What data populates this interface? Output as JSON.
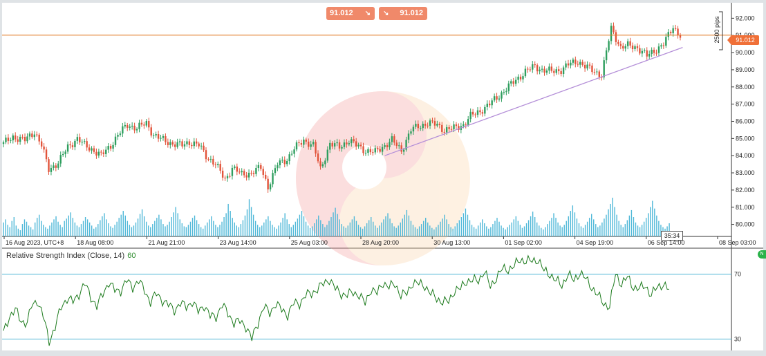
{
  "quotes": {
    "sell_price": "91.012",
    "buy_price": "91.012",
    "sell_arrow": "↘",
    "buy_arrow": "↘"
  },
  "price_tag": "91.012",
  "pips_label": "2500 pips",
  "timer": "35:34",
  "rsi_label": {
    "name": "Relative Strength Index (Close, 14)",
    "value": "60"
  },
  "green_tab_icon": "N",
  "colors": {
    "up": "#2e9e5e",
    "down": "#e2533a",
    "volume": "#4fb8d8",
    "price_line": "#e07a25",
    "trendline": "#b48fd8",
    "rsi_line": "#1c7a1c",
    "rsi_level": "#4cb3d4"
  },
  "chart_data": [
    {
      "type": "candlestick",
      "xlabels": [
        "16 Aug 2023, UTC+8",
        "18 Aug 08:00",
        "21 Aug 21:00",
        "23 Aug 14:00",
        "25 Aug 03:00",
        "28 Aug 20:00",
        "30 Aug 13:00",
        "01 Sep 02:00",
        "04 Sep 19:00",
        "06 Sep 14:00",
        "08 Sep 03:00"
      ],
      "yticks": [
        "80.000",
        "81.000",
        "82.000",
        "83.000",
        "84.000",
        "85.000",
        "86.000",
        "87.000",
        "88.000",
        "89.000",
        "90.000",
        "91.000",
        "92.000"
      ],
      "ylim": [
        79.3,
        92.9
      ],
      "current_price": 91.012,
      "close_anchors": [
        [
          0,
          84.7
        ],
        [
          4,
          85.1
        ],
        [
          9,
          84.9
        ],
        [
          13,
          85.4
        ],
        [
          16,
          84.6
        ],
        [
          19,
          83.2
        ],
        [
          23,
          83.6
        ],
        [
          27,
          84.5
        ],
        [
          31,
          85.0
        ],
        [
          34,
          84.6
        ],
        [
          38,
          84.3
        ],
        [
          41,
          84.0
        ],
        [
          45,
          84.6
        ],
        [
          48,
          85.2
        ],
        [
          52,
          85.8
        ],
        [
          56,
          85.6
        ],
        [
          60,
          85.9
        ],
        [
          63,
          85.2
        ],
        [
          67,
          84.9
        ],
        [
          71,
          84.7
        ],
        [
          75,
          84.6
        ],
        [
          78,
          84.8
        ],
        [
          82,
          84.6
        ],
        [
          85,
          84.0
        ],
        [
          89,
          83.5
        ],
        [
          93,
          82.6
        ],
        [
          96,
          83.3
        ],
        [
          100,
          82.9
        ],
        [
          104,
          83.0
        ],
        [
          108,
          83.3
        ],
        [
          111,
          82.2
        ],
        [
          115,
          83.5
        ],
        [
          119,
          83.8
        ],
        [
          122,
          84.4
        ],
        [
          126,
          84.9
        ],
        [
          130,
          84.6
        ],
        [
          133,
          83.2
        ],
        [
          137,
          84.7
        ],
        [
          141,
          84.5
        ],
        [
          145,
          84.9
        ],
        [
          148,
          84.6
        ],
        [
          152,
          84.3
        ],
        [
          156,
          84.2
        ],
        [
          159,
          84.5
        ],
        [
          163,
          84.9
        ],
        [
          167,
          84.3
        ],
        [
          171,
          85.5
        ],
        [
          174,
          85.7
        ],
        [
          178,
          85.9
        ],
        [
          182,
          85.8
        ],
        [
          185,
          85.5
        ],
        [
          189,
          85.6
        ],
        [
          193,
          85.8
        ],
        [
          196,
          86.3
        ],
        [
          200,
          86.6
        ],
        [
          204,
          87.0
        ],
        [
          208,
          87.5
        ],
        [
          211,
          87.9
        ],
        [
          215,
          88.4
        ],
        [
          219,
          88.9
        ],
        [
          223,
          89.2
        ],
        [
          226,
          89.0
        ],
        [
          230,
          88.9
        ],
        [
          234,
          89.0
        ],
        [
          237,
          89.3
        ],
        [
          241,
          89.5
        ],
        [
          244,
          89.2
        ],
        [
          248,
          88.9
        ],
        [
          251,
          88.7
        ],
        [
          255,
          91.4
        ],
        [
          259,
          90.3
        ],
        [
          262,
          90.4
        ],
        [
          266,
          90.3
        ],
        [
          270,
          89.8
        ],
        [
          273,
          90.1
        ],
        [
          277,
          90.5
        ],
        [
          281,
          91.5
        ],
        [
          284,
          91.0
        ]
      ],
      "volume": [
        18,
        22,
        15,
        12,
        20,
        25,
        14,
        10,
        8,
        16,
        22,
        19,
        14,
        12,
        9,
        18,
        24,
        28,
        20,
        15,
        12,
        10,
        14,
        18,
        22,
        26,
        19,
        15,
        12,
        20,
        23,
        27,
        31,
        24,
        18,
        14,
        12,
        16,
        20,
        25,
        22,
        18,
        14,
        10,
        12,
        16,
        21,
        26,
        30,
        22,
        17,
        13,
        11,
        15,
        19,
        24,
        28,
        33,
        27,
        20,
        15,
        12,
        14,
        18,
        23,
        29,
        35,
        26,
        19,
        14,
        12,
        16,
        20,
        24,
        28,
        22,
        16,
        13,
        15,
        19,
        25,
        31,
        38,
        30,
        22,
        17,
        13,
        12,
        15,
        19,
        24,
        27,
        21,
        16,
        12,
        10,
        14,
        18,
        22,
        26,
        20,
        15,
        12,
        15,
        19,
        25,
        30,
        42,
        33,
        24,
        18,
        14,
        12,
        16,
        21,
        27,
        35,
        48,
        38,
        28,
        20,
        15,
        12,
        14,
        18,
        22,
        26,
        20,
        15,
        12,
        10,
        14,
        18,
        24,
        30,
        22,
        16,
        12,
        15,
        19,
        23,
        28,
        33,
        26,
        19,
        14,
        11,
        13,
        17,
        22,
        27,
        21,
        16,
        12,
        15,
        20,
        25,
        31,
        37,
        29,
        22,
        16,
        13,
        11,
        14,
        18,
        22,
        26,
        20,
        15,
        12,
        10,
        13,
        17,
        21,
        25,
        19,
        14,
        11,
        14,
        18,
        22,
        26,
        30,
        23,
        17,
        13,
        11,
        14,
        18,
        23,
        28,
        34,
        27,
        20,
        15,
        12,
        10,
        13,
        16,
        20,
        24,
        18,
        14,
        11,
        9,
        12,
        15,
        19,
        23,
        28,
        22,
        16,
        12,
        10,
        13,
        17,
        21,
        25,
        30,
        36,
        28,
        21,
        15,
        12,
        10,
        14,
        18,
        22,
        17,
        13,
        10,
        12,
        16,
        20,
        24,
        19,
        14,
        11,
        9,
        12,
        15,
        18,
        22,
        26,
        20,
        15,
        11,
        13,
        17,
        21,
        26,
        32,
        25,
        18,
        14,
        11,
        9,
        12,
        16,
        20,
        24,
        30,
        24,
        18,
        14,
        12,
        15,
        20,
        26,
        33,
        40,
        31,
        23,
        17,
        13,
        11,
        15,
        19,
        24,
        29,
        22,
        16,
        12,
        14,
        18,
        23,
        28,
        35,
        42,
        50,
        38,
        28,
        20,
        15,
        12,
        16,
        21,
        27,
        34,
        25,
        18,
        14,
        12,
        15,
        19,
        24,
        30,
        38,
        46,
        36,
        27,
        20,
        15,
        12,
        10,
        13,
        17
      ],
      "trendline": [
        [
          160,
          84.0
        ],
        [
          285,
          90.3
        ]
      ]
    },
    {
      "type": "line",
      "name": "Relative Strength Index (Close, 14)",
      "levels": [
        30,
        70
      ],
      "ylim": [
        23,
        86
      ],
      "anchors": [
        [
          0,
          34
        ],
        [
          3,
          44
        ],
        [
          6,
          48
        ],
        [
          9,
          41
        ],
        [
          12,
          40
        ],
        [
          14,
          50
        ],
        [
          17,
          54
        ],
        [
          20,
          44
        ],
        [
          23,
          29
        ],
        [
          26,
          37
        ],
        [
          29,
          50
        ],
        [
          32,
          55
        ],
        [
          35,
          53
        ],
        [
          38,
          58
        ],
        [
          41,
          64
        ],
        [
          44,
          56
        ],
        [
          47,
          50
        ],
        [
          50,
          58
        ],
        [
          53,
          65
        ],
        [
          56,
          60
        ],
        [
          59,
          60
        ],
        [
          62,
          66
        ],
        [
          65,
          62
        ],
        [
          68,
          66
        ],
        [
          71,
          60
        ],
        [
          74,
          53
        ],
        [
          77,
          58
        ],
        [
          80,
          54
        ],
        [
          83,
          51
        ],
        [
          86,
          48
        ],
        [
          89,
          52
        ],
        [
          92,
          50
        ],
        [
          95,
          53
        ],
        [
          98,
          47
        ],
        [
          101,
          51
        ],
        [
          104,
          44
        ],
        [
          107,
          44
        ],
        [
          110,
          51
        ],
        [
          113,
          46
        ],
        [
          116,
          40
        ],
        [
          119,
          41
        ],
        [
          122,
          38
        ],
        [
          125,
          30
        ],
        [
          128,
          40
        ],
        [
          131,
          50
        ],
        [
          134,
          46
        ],
        [
          137,
          52
        ],
        [
          140,
          48
        ],
        [
          143,
          45
        ],
        [
          146,
          52
        ],
        [
          149,
          52
        ],
        [
          152,
          57
        ],
        [
          155,
          58
        ],
        [
          158,
          61
        ],
        [
          161,
          64
        ],
        [
          164,
          67
        ],
        [
          167,
          61
        ],
        [
          170,
          58
        ],
        [
          173,
          57
        ],
        [
          176,
          59
        ],
        [
          179,
          57
        ],
        [
          182,
          52
        ],
        [
          185,
          61
        ],
        [
          188,
          58
        ],
        [
          191,
          65
        ],
        [
          194,
          62
        ],
        [
          197,
          64
        ],
        [
          200,
          57
        ],
        [
          203,
          58
        ],
        [
          206,
          65
        ],
        [
          209,
          64
        ],
        [
          212,
          63
        ],
        [
          215,
          58
        ],
        [
          218,
          55
        ],
        [
          221,
          53
        ],
        [
          224,
          53
        ],
        [
          227,
          60
        ],
        [
          230,
          61
        ],
        [
          233,
          66
        ],
        [
          236,
          66
        ],
        [
          239,
          66
        ],
        [
          242,
          72
        ],
        [
          245,
          62
        ],
        [
          248,
          68
        ],
        [
          251,
          73
        ],
        [
          254,
          73
        ],
        [
          257,
          75
        ],
        [
          260,
          79
        ],
        [
          263,
          78
        ],
        [
          266,
          78
        ],
        [
          269,
          79
        ],
        [
          272,
          72
        ],
        [
          275,
          70
        ],
        [
          278,
          66
        ],
        [
          281,
          63
        ],
        [
          284,
          70
        ],
        [
          287,
          66
        ],
        [
          290,
          71
        ],
        [
          293,
          67
        ],
        [
          296,
          62
        ],
        [
          299,
          57
        ],
        [
          302,
          52
        ],
        [
          305,
          50
        ],
        [
          308,
          70
        ],
        [
          311,
          64
        ],
        [
          314,
          68
        ],
        [
          317,
          62
        ],
        [
          320,
          61
        ],
        [
          323,
          63
        ],
        [
          326,
          57
        ],
        [
          329,
          62
        ],
        [
          332,
          64
        ],
        [
          335,
          60
        ]
      ]
    }
  ]
}
